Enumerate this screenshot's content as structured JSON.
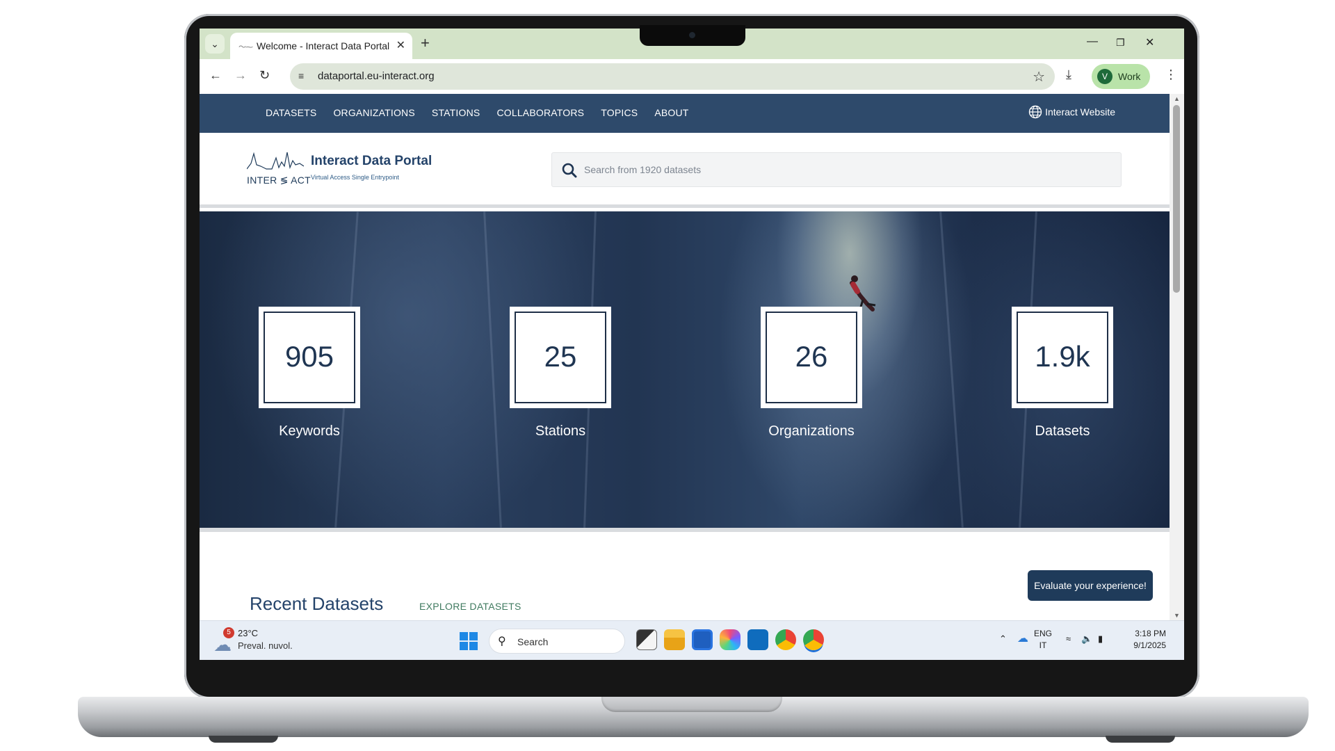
{
  "browser": {
    "tab_title": "Welcome - Interact Data Portal",
    "url": "dataportal.eu-interact.org",
    "profile_initial": "V",
    "profile_label": "Work",
    "profile_color": "#b9e3a9"
  },
  "site": {
    "nav_color": "#2e4a6b",
    "nav": [
      "DATASETS",
      "ORGANIZATIONS",
      "STATIONS",
      "COLLABORATORS",
      "TOPICS",
      "ABOUT"
    ],
    "external_link": "Interact Website",
    "logo_text": "INTER ≶ ACT",
    "brand_title": "Interact Data Portal",
    "brand_subtitle": "Virtual Access Single Entrypoint",
    "search_placeholder": "Search from 1920 datasets"
  },
  "stats": [
    {
      "value": "905",
      "label": "Keywords"
    },
    {
      "value": "25",
      "label": "Stations"
    },
    {
      "value": "26",
      "label": "Organizations"
    },
    {
      "value": "1.9k",
      "label": "Datasets"
    }
  ],
  "recent": {
    "title": "Recent Datasets",
    "explore_label": "EXPLORE DATASETS"
  },
  "feedback_label": "Evaluate your experience!",
  "taskbar": {
    "weather_badge": "5",
    "temperature": "23°C",
    "condition": "Preval. nuvol.",
    "search_label": "Search",
    "lang_primary": "ENG",
    "lang_secondary": "IT",
    "time": "3:18 PM",
    "date": "9/1/2025"
  },
  "icons": {
    "tab_menu": "chevron-down-icon",
    "close": "close-icon",
    "new_tab": "plus-icon",
    "back": "back-arrow-icon",
    "forward": "forward-arrow-icon",
    "reload": "reload-icon",
    "bookmark": "star-icon",
    "download": "download-icon",
    "menu": "kebab-icon",
    "globe": "globe-icon",
    "search": "search-icon"
  }
}
